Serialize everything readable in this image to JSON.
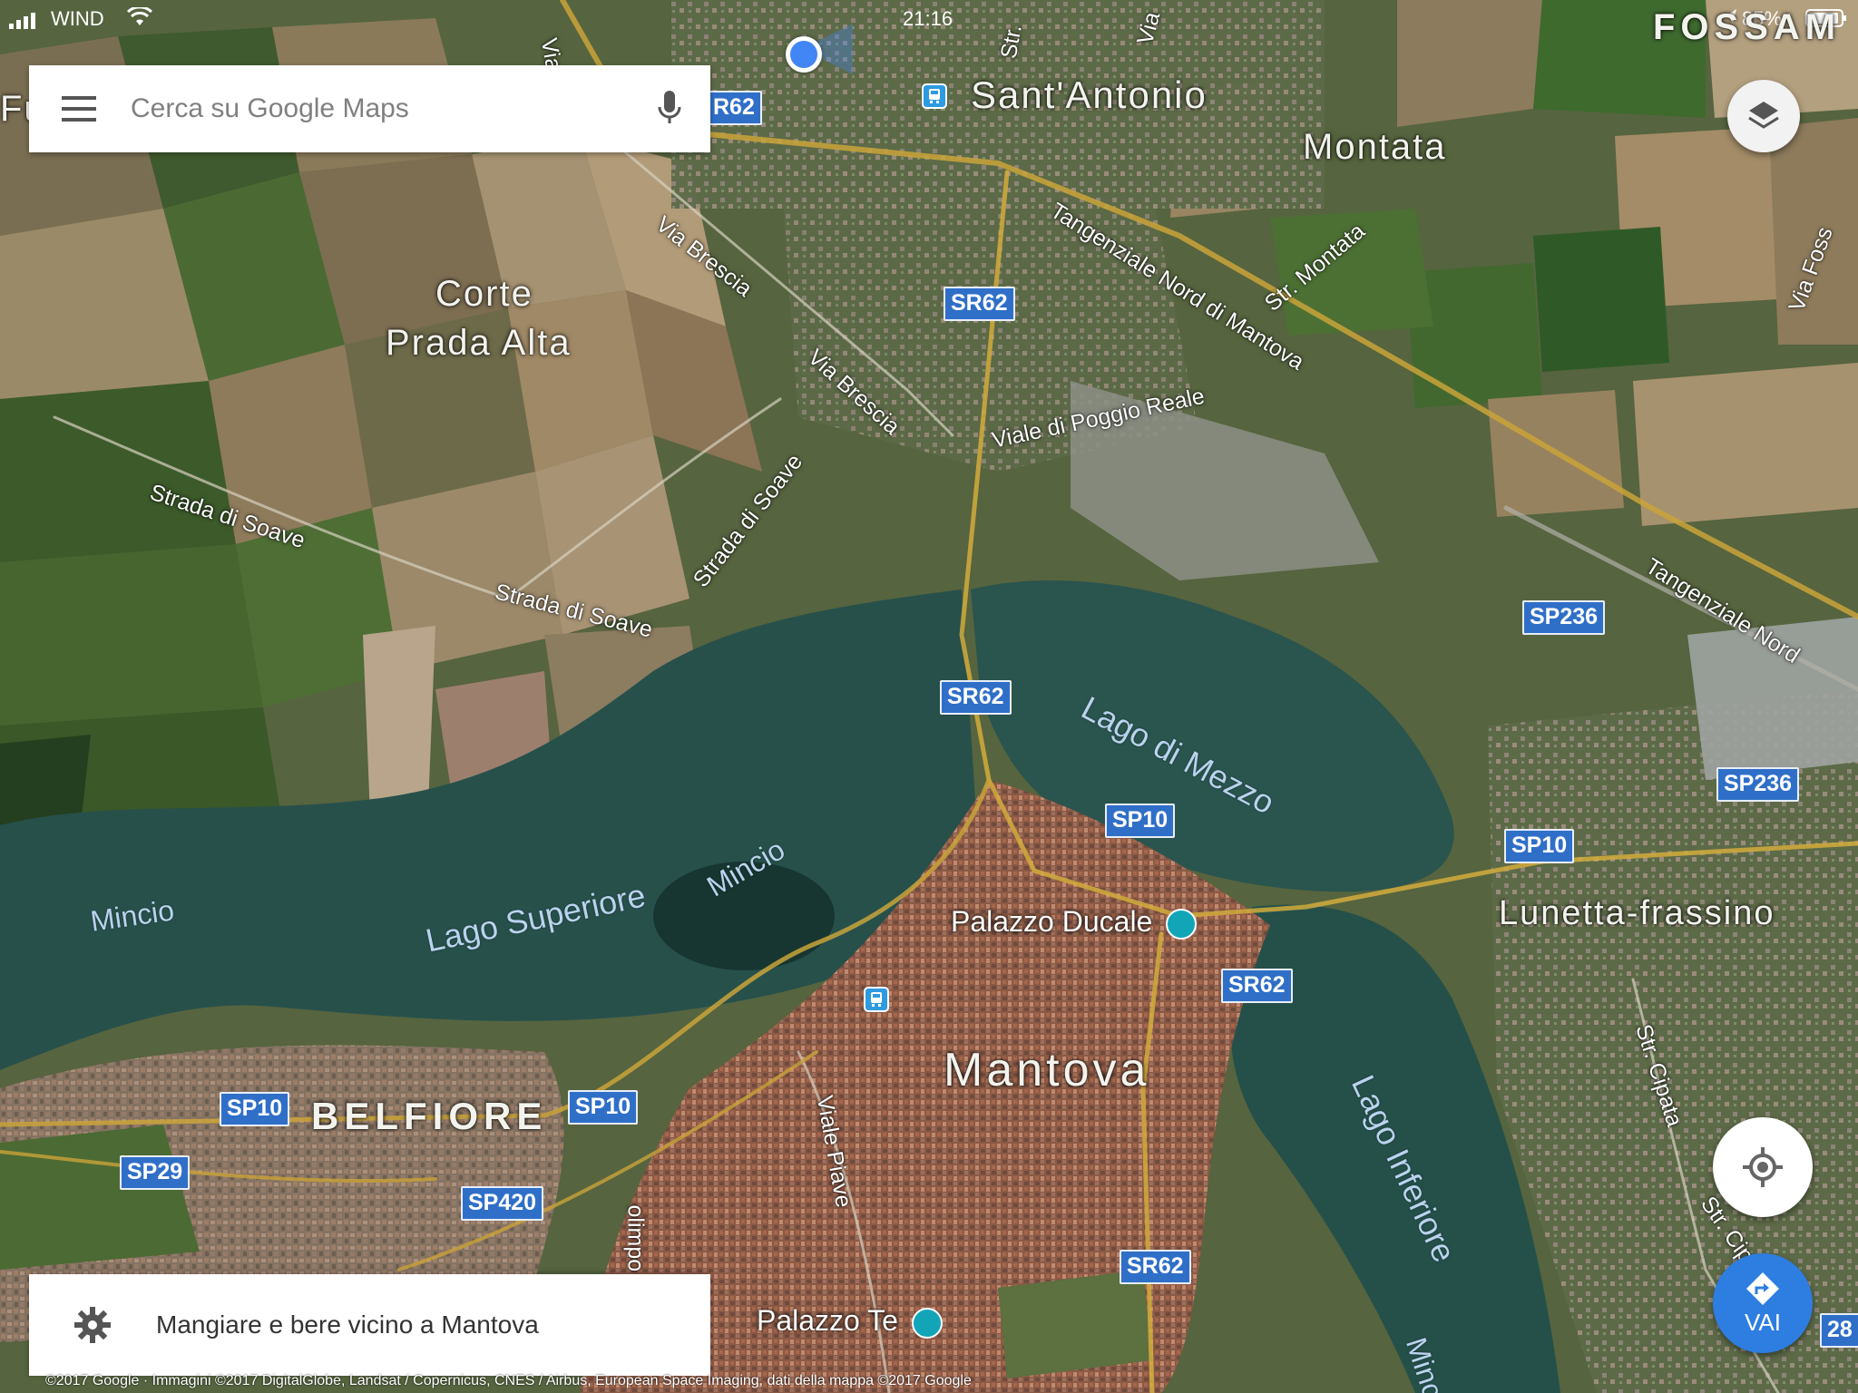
{
  "status_bar": {
    "carrier": "WIND",
    "time": "21:16",
    "battery": "85%"
  },
  "search": {
    "placeholder": "Cerca su Google Maps"
  },
  "map": {
    "places": {
      "sant_antonio": "Sant'Antonio",
      "montata": "Montata",
      "corte": "Corte",
      "prada_alta": "Prada Alta",
      "mantova": "Mantova",
      "belfiore": "BELFIORE",
      "lunetta": "Lunetta-frassino",
      "fossamana": "FOSSAM",
      "fu": "Fu"
    },
    "pois": {
      "palazzo_ducale": "Palazzo Ducale",
      "palazzo_te": "Palazzo Te"
    },
    "water": {
      "lago_superiore": "Lago Superiore",
      "lago_di_mezzo": "Lago di Mezzo",
      "lago_inferiore": "Lago Inferiore",
      "mincio_1": "Mincio",
      "mincio_2": "Mincio",
      "mincio_3": "Minc"
    },
    "streets": {
      "via_brescia_1": "Via Brescia",
      "via_brescia_2": "Via Brescia",
      "tangenziale_1": "Tangenziale Nord di Mantova",
      "tangenziale_2": "Tangenziale Nord",
      "str_montata": "Str. Montata",
      "viale_poggio_reale": "Viale di Poggio Reale",
      "strada_soave_1": "Strada di Soave",
      "strada_soave_2": "Strada di Soave",
      "strada_soave_3": "Strada di Soave",
      "via_foss": "Via Foss",
      "viale_piave": "Viale Piave",
      "str_cipata_1": "Str. Cipata",
      "str_cipata_2": "Str. Cipata",
      "via_top_1": "Via",
      "via_top_2": "Via",
      "str_top": "Str.",
      "olimpo": "olimpo"
    },
    "road_shields": {
      "sr62_a": "R62",
      "sr62_b": "SR62",
      "sr62_c": "SR62",
      "sr62_d": "SR62",
      "sr62_e": "SR62",
      "sp10_a": "SP10",
      "sp10_b": "SP10",
      "sp10_c": "SP10",
      "sp10_d": "SP10",
      "sp236_a": "SP236",
      "sp236_b": "SP236",
      "sp29": "SP29",
      "sp420": "SP420",
      "n28": "28"
    }
  },
  "bottom_card": {
    "label": "Mangiare e bere vicino a Mantova"
  },
  "navigate_button": {
    "label": "VAI"
  },
  "copyright": "©2017 Google · Immagini ©2017 DigitalGlobe, Landsat / Copernicus, CNES / Airbus, European Space Imaging, dati della mappa ©2017 Google",
  "colors": {
    "accent_blue": "#2f6fc8",
    "fab_blue": "#2e7de0",
    "location_blue": "#4285f4"
  }
}
